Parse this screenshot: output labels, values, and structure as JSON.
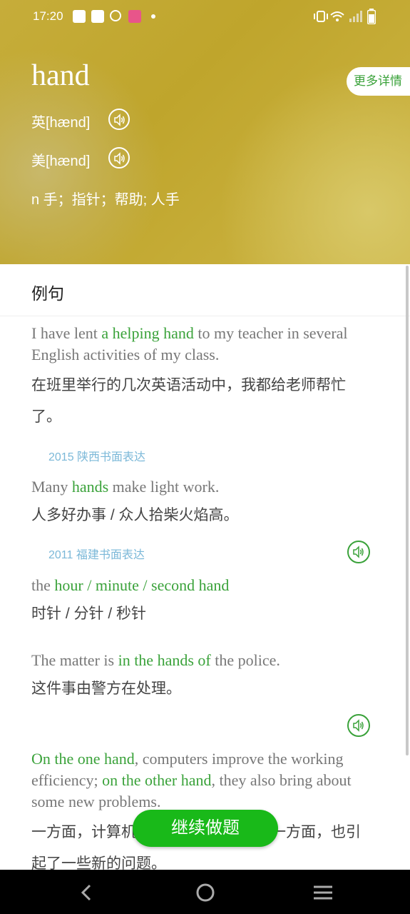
{
  "status": {
    "time": "17:20"
  },
  "header": {
    "word": "hand",
    "more_label": "更多详情",
    "uk_pron": "英[hænd]",
    "us_pron": "美[hænd]",
    "definition": "n 手；指针；帮助; 人手"
  },
  "section": {
    "title": "例句"
  },
  "examples": [
    {
      "en_parts": [
        "I have lent ",
        "a helping hand",
        " to my teacher in several English activities of my class."
      ],
      "zh": "在班里举行的几次英语活动中，我都给老师帮忙了。",
      "source": "2015 陕西书面表达"
    },
    {
      "en_parts": [
        "Many ",
        "hands",
        " make light work."
      ],
      "zh": "人多好办事 / 众人拾柴火焰高。",
      "source": "2011 福建书面表达"
    },
    {
      "en_parts": [
        "the ",
        "hour / minute / second hand"
      ],
      "zh": "时针 / 分针 / 秒针"
    },
    {
      "en_parts": [
        "The matter is ",
        "in the hands of",
        " the police."
      ],
      "zh": "这件事由警方在处理。"
    },
    {
      "en_parts": [
        "On the one hand",
        ", computers improve the working efficiency; ",
        "on the other hand",
        ", they also bring about some new problems."
      ],
      "zh": "一方面，计算机提高了工作效率，另一方面，也引起了一些新的问题。"
    }
  ],
  "continue_label": "继续做题",
  "colors": {
    "accent": "#3aa23a",
    "button": "#19b919",
    "hero": "#c6ad3a"
  }
}
